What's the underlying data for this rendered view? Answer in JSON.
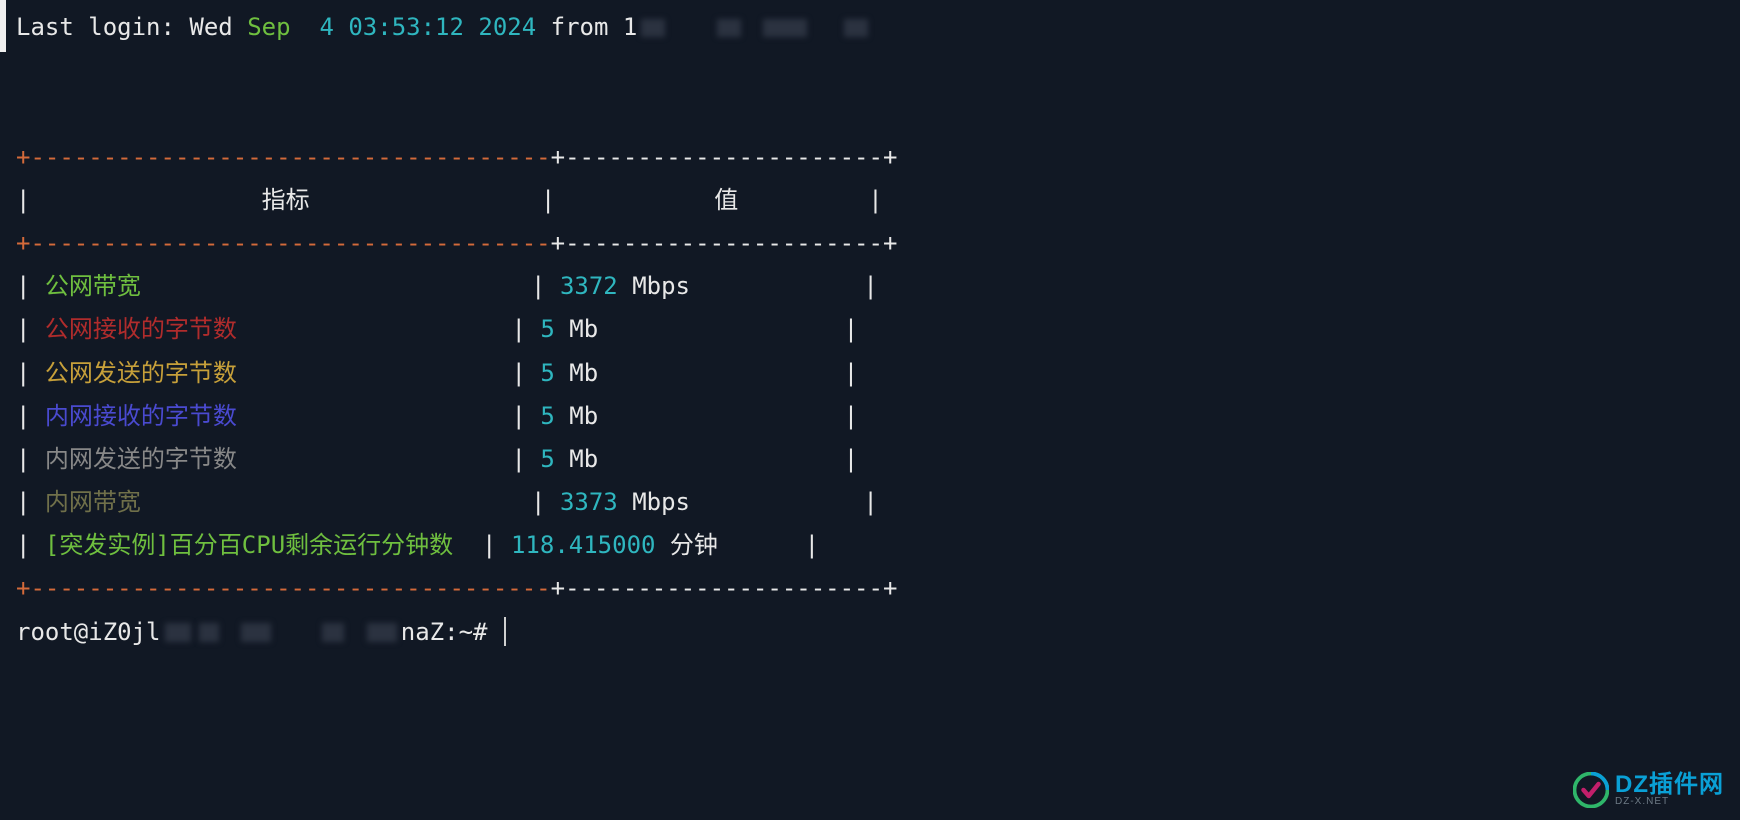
{
  "login": {
    "prefix": "Last login: Wed ",
    "month": "Sep",
    "day_time": "  4 03:53:12",
    "year": " 2024",
    "from": " from 1"
  },
  "table": {
    "border_top": "+----------------------------------------+----------------------+",
    "header_line": "|                 指标                   |          值          |",
    "header_metric": "指标",
    "header_value": "值",
    "rows": [
      {
        "label": "公网带宽",
        "val_num": "3372",
        "val_unit": " Mbps",
        "label_cls": "c-green"
      },
      {
        "label": "公网接收的字节数",
        "val_num": "5",
        "val_unit": " Mb",
        "label_cls": "c-red"
      },
      {
        "label": "公网发送的字节数",
        "val_num": "5",
        "val_unit": " Mb",
        "label_cls": "c-yellow"
      },
      {
        "label": "内网接收的字节数",
        "val_num": "5",
        "val_unit": " Mb",
        "label_cls": "c-blue"
      },
      {
        "label": "内网发送的字节数",
        "val_num": "5",
        "val_unit": " Mb",
        "label_cls": "c-gray"
      },
      {
        "label": "内网带宽",
        "val_num": "3373",
        "val_unit": " Mbps",
        "label_cls": "c-olive"
      },
      {
        "label": "[突发实例]百分百CPU剩余运行分钟数",
        "val_num": "118.415000",
        "val_unit": " 分钟",
        "label_cls": "c-green"
      }
    ],
    "col1_width": 34,
    "col2_num_width": 11
  },
  "prompt": {
    "user_host_pre": "root@iZ0jl",
    "user_host_post": "naZ:~# "
  },
  "watermark": {
    "title": "DZ插件网",
    "sub": "DZ-X.NET"
  }
}
